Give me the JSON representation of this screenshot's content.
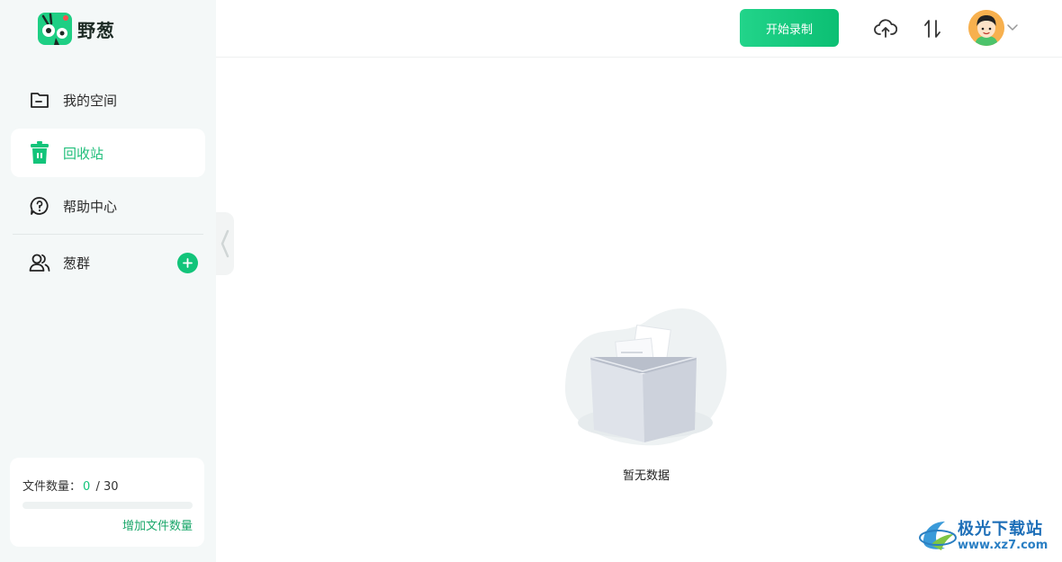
{
  "app": {
    "name": "野葱"
  },
  "sidebar": {
    "items": [
      {
        "label": "我的空间",
        "icon": "folder-icon",
        "active": false
      },
      {
        "label": "回收站",
        "icon": "trash-icon",
        "active": true
      },
      {
        "label": "帮助中心",
        "icon": "help-circle-icon",
        "active": false
      },
      {
        "label": "葱群",
        "icon": "users-icon",
        "active": false
      }
    ]
  },
  "quota": {
    "label": "文件数量：",
    "used": "0",
    "separator": "/",
    "total": "30",
    "fraction": 0,
    "link_label": "增加文件数量"
  },
  "topbar": {
    "record_label": "开始录制",
    "upload_icon": "cloud-upload-icon",
    "transfer_icon": "transfer-icon",
    "avatar_icon": "user-avatar"
  },
  "main": {
    "empty_text": "暂无数据"
  },
  "watermark": {
    "title": "极光下载站",
    "url": "www.xz7.com"
  },
  "colors": {
    "accent": "#12c47a",
    "sidebar_bg": "#f4f8f8",
    "link": "#1aa76a"
  }
}
